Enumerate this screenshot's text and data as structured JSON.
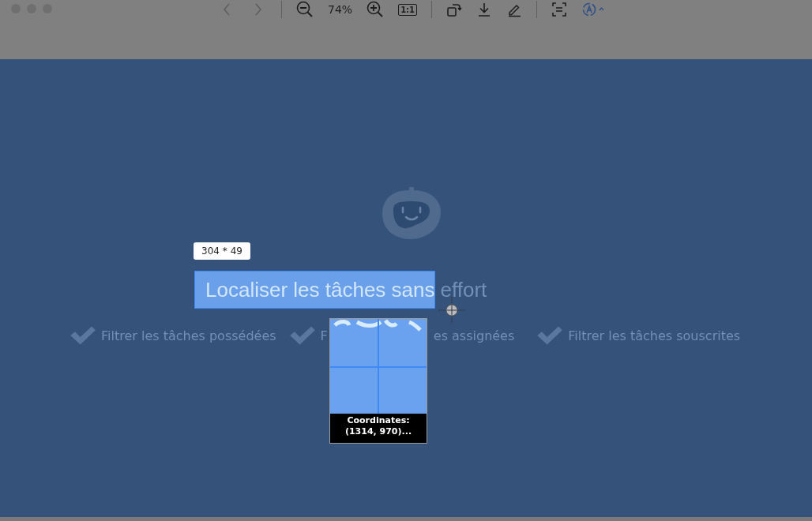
{
  "toolbar": {
    "zoom": "74%",
    "actual_size": "1:1"
  },
  "hero": {
    "title_parts": [
      "Localiser les tâches sans",
      "effort"
    ],
    "features": [
      {
        "parts": [
          "Filtrer les tâches possédées"
        ]
      },
      {
        "parts": [
          "F",
          "es assignées"
        ]
      },
      {
        "parts": [
          "Filtrer les tâches souscrites"
        ]
      }
    ]
  },
  "capture": {
    "size": "304 * 49",
    "coordinates": "Coordinates: (1314, 970)..."
  }
}
